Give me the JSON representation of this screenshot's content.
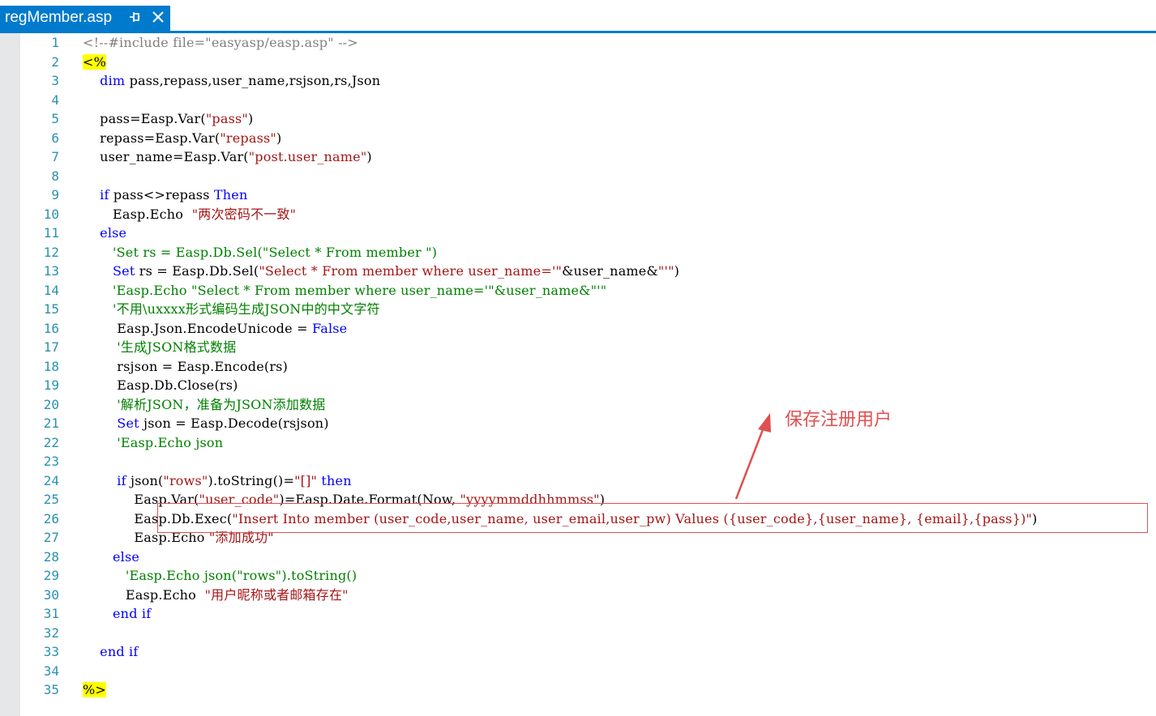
{
  "tab": {
    "title": "regMember.asp"
  },
  "lines": [
    {
      "n": "1",
      "segs": [
        {
          "t": "<!--#include file=\"easyasp/easp.asp\" -->",
          "c": "gray"
        }
      ]
    },
    {
      "n": "2",
      "segs": [
        {
          "t": "<%",
          "c": "hl"
        }
      ]
    },
    {
      "n": "3",
      "segs": [
        {
          "t": "    "
        },
        {
          "t": "dim",
          "c": "kw"
        },
        {
          "t": " pass,repass,user_name,rsjson,rs,Json"
        }
      ]
    },
    {
      "n": "4",
      "segs": []
    },
    {
      "n": "5",
      "segs": [
        {
          "t": "    pass=Easp.Var("
        },
        {
          "t": "\"pass\"",
          "c": "str"
        },
        {
          "t": ")"
        }
      ]
    },
    {
      "n": "6",
      "segs": [
        {
          "t": "    repass=Easp.Var("
        },
        {
          "t": "\"repass\"",
          "c": "str"
        },
        {
          "t": ")"
        }
      ]
    },
    {
      "n": "7",
      "segs": [
        {
          "t": "    user_name=Easp.Var("
        },
        {
          "t": "\"post.user_name\"",
          "c": "str"
        },
        {
          "t": ")"
        }
      ]
    },
    {
      "n": "8",
      "segs": []
    },
    {
      "n": "9",
      "segs": [
        {
          "t": "    "
        },
        {
          "t": "if",
          "c": "kw"
        },
        {
          "t": " pass<>repass "
        },
        {
          "t": "Then",
          "c": "kw"
        }
      ]
    },
    {
      "n": "10",
      "segs": [
        {
          "t": "       Easp.Echo  "
        },
        {
          "t": "\"两次密码不一致\"",
          "c": "str"
        }
      ]
    },
    {
      "n": "11",
      "segs": [
        {
          "t": "    "
        },
        {
          "t": "else",
          "c": "kw"
        }
      ]
    },
    {
      "n": "12",
      "segs": [
        {
          "t": "       "
        },
        {
          "t": "'Set rs = Easp.Db.Sel(\"Select * From member \")",
          "c": "cm"
        }
      ]
    },
    {
      "n": "13",
      "segs": [
        {
          "t": "       "
        },
        {
          "t": "Set",
          "c": "kw"
        },
        {
          "t": " rs = Easp.Db.Sel("
        },
        {
          "t": "\"Select * From member where user_name='\"",
          "c": "str"
        },
        {
          "t": "&user_name&"
        },
        {
          "t": "\"'\"",
          "c": "str"
        },
        {
          "t": ")"
        }
      ]
    },
    {
      "n": "14",
      "segs": [
        {
          "t": "       "
        },
        {
          "t": "'Easp.Echo \"Select * From member where user_name='\"&user_name&\"'\"",
          "c": "cm"
        }
      ]
    },
    {
      "n": "15",
      "segs": [
        {
          "t": "       "
        },
        {
          "t": "'不用\\uxxxx形式编码生成JSON中的中文字符",
          "c": "cm"
        }
      ]
    },
    {
      "n": "16",
      "segs": [
        {
          "t": "        Easp.Json.EncodeUnicode = "
        },
        {
          "t": "False",
          "c": "kw"
        }
      ]
    },
    {
      "n": "17",
      "segs": [
        {
          "t": "        "
        },
        {
          "t": "'生成JSON格式数据",
          "c": "cm"
        }
      ]
    },
    {
      "n": "18",
      "segs": [
        {
          "t": "        rsjson = Easp.Encode(rs)"
        }
      ]
    },
    {
      "n": "19",
      "segs": [
        {
          "t": "        Easp.Db.Close(rs)"
        }
      ]
    },
    {
      "n": "20",
      "segs": [
        {
          "t": "        "
        },
        {
          "t": "'解析JSON，准备为JSON添加数据",
          "c": "cm"
        }
      ]
    },
    {
      "n": "21",
      "segs": [
        {
          "t": "        "
        },
        {
          "t": "Set",
          "c": "kw"
        },
        {
          "t": " json = Easp.Decode(rsjson)"
        }
      ]
    },
    {
      "n": "22",
      "segs": [
        {
          "t": "        "
        },
        {
          "t": "'Easp.Echo json",
          "c": "cm"
        }
      ]
    },
    {
      "n": "23",
      "segs": []
    },
    {
      "n": "24",
      "segs": [
        {
          "t": "        "
        },
        {
          "t": "if",
          "c": "kw"
        },
        {
          "t": " json("
        },
        {
          "t": "\"rows\"",
          "c": "str"
        },
        {
          "t": ").toString()="
        },
        {
          "t": "\"[]\"",
          "c": "str"
        },
        {
          "t": " "
        },
        {
          "t": "then",
          "c": "kw"
        }
      ]
    },
    {
      "n": "25",
      "segs": [
        {
          "t": "            Easp.Var("
        },
        {
          "t": "\"user_code\"",
          "c": "str"
        },
        {
          "t": ")=Easp.Date.Format(Now, "
        },
        {
          "t": "\"yyyymmddhhmmss\"",
          "c": "str"
        },
        {
          "t": ")"
        }
      ]
    },
    {
      "n": "26",
      "segs": [
        {
          "t": "            Easp.Db.Exec("
        },
        {
          "t": "\"Insert Into member (user_code,user_name, user_email,user_pw) Values ({user_code},{user_name}, {email},{pass})\"",
          "c": "str"
        },
        {
          "t": ")"
        }
      ]
    },
    {
      "n": "27",
      "segs": [
        {
          "t": "            Easp.Echo "
        },
        {
          "t": "\"添加成功\"",
          "c": "str"
        }
      ]
    },
    {
      "n": "28",
      "segs": [
        {
          "t": "       "
        },
        {
          "t": "else",
          "c": "kw"
        }
      ]
    },
    {
      "n": "29",
      "segs": [
        {
          "t": "          "
        },
        {
          "t": "'Easp.Echo json(\"rows\").toString()",
          "c": "cm"
        }
      ]
    },
    {
      "n": "30",
      "segs": [
        {
          "t": "          Easp.Echo  "
        },
        {
          "t": "\"用户昵称或者邮箱存在\"",
          "c": "str"
        }
      ]
    },
    {
      "n": "31",
      "segs": [
        {
          "t": "       "
        },
        {
          "t": "end if",
          "c": "kw"
        }
      ]
    },
    {
      "n": "32",
      "segs": []
    },
    {
      "n": "33",
      "segs": [
        {
          "t": "    "
        },
        {
          "t": "end if",
          "c": "kw"
        }
      ]
    },
    {
      "n": "34",
      "segs": []
    },
    {
      "n": "35",
      "segs": [
        {
          "t": "%>",
          "c": "hl"
        }
      ]
    }
  ],
  "annotation": {
    "text": "保存注册用户",
    "color": "#e05050"
  },
  "colors": {
    "accent": "#007acc",
    "keyword": "#0000ff",
    "string": "#a31515",
    "comment": "#008000",
    "line_number": "#2b91af"
  }
}
